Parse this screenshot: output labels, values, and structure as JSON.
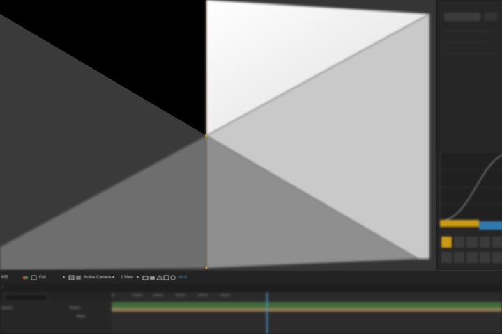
{
  "composition_view": {
    "colors": {
      "black": "#000000",
      "white": "#ffffff",
      "grey_dark": "#353535",
      "grey_mid": "#9a9a9a",
      "grey_light": "#c9c9c9"
    }
  },
  "view_toolbar": {
    "zoom_value": "655",
    "resolution": "Full",
    "camera": "Active Camera",
    "views": "1 View",
    "exposure": "+0.0",
    "icons": [
      "color-wheel-icon",
      "grid-icon",
      "region-icon",
      "snapshot-icon",
      "show-snapshot-icon",
      "channel-icon",
      "reset-exposure-icon"
    ]
  },
  "timeline": {
    "close_glyph": "×",
    "ruler_ticks": [
      "0f",
      "00005",
      "00010",
      "00015",
      "00020",
      "00025"
    ],
    "parent_header": "Parent",
    "source_header": "Source",
    "parent_value": "None"
  },
  "accent_colors": {
    "yellow": "#c99a12",
    "blue": "#2f7bb0",
    "green": "#3e6b3a"
  }
}
